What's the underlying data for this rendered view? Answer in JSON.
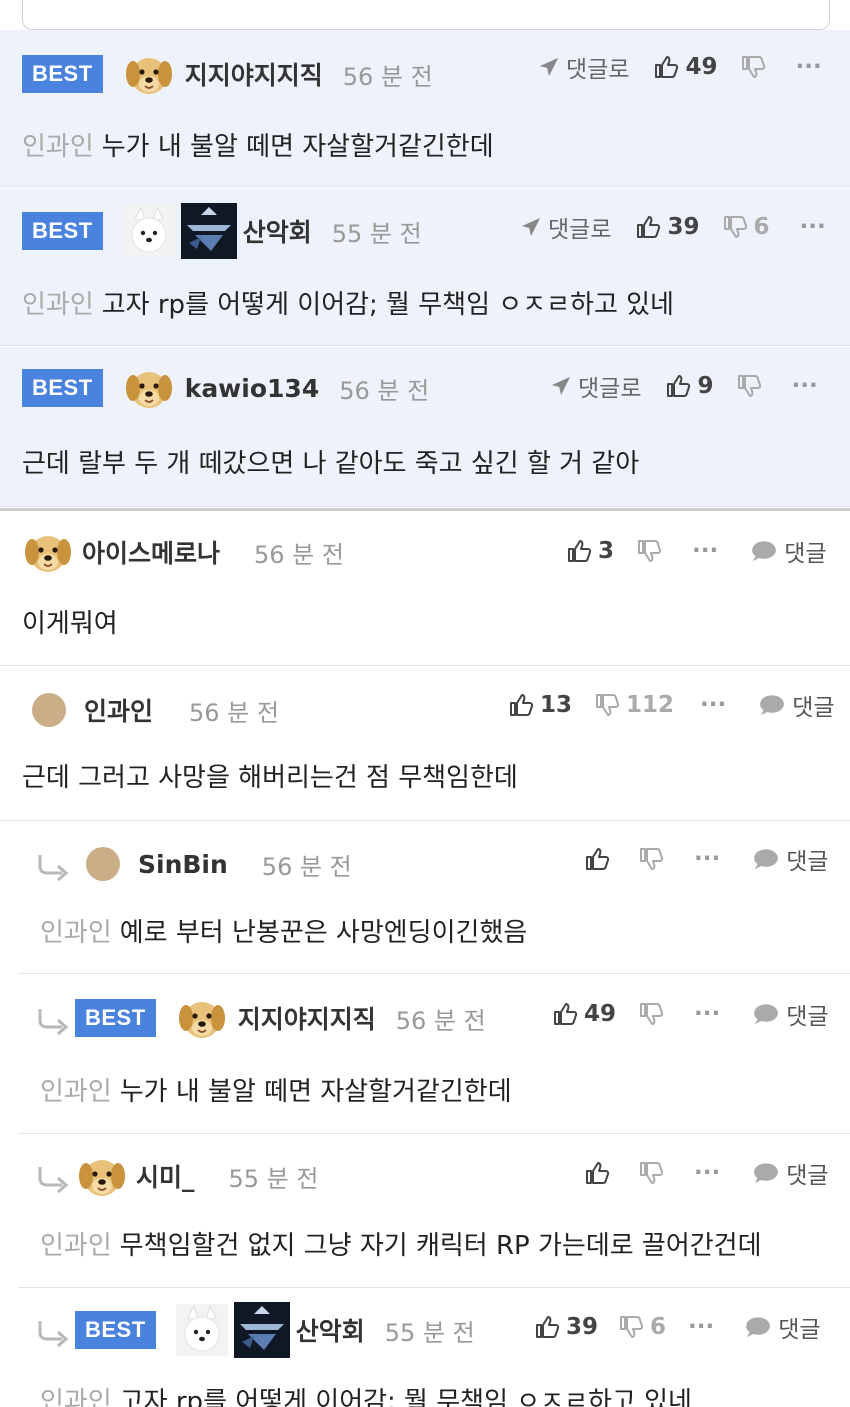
{
  "best_comments": [
    {
      "badge": "BEST",
      "nick": "지지야지지직",
      "time": "56 분 전",
      "reply_label": "댓글로",
      "likes": "49",
      "dislikes": "",
      "prefix": "인과인",
      "text": "누가 내 불알 떼면 자살할거같긴한데"
    },
    {
      "badge": "BEST",
      "nick": "산악회",
      "time": "55 분 전",
      "reply_label": "댓글로",
      "likes": "39",
      "dislikes": "6",
      "prefix": "인과인",
      "text": "고자 rp를 어떻게 이어감; 뭘 무책임 ㅇㅈㄹ하고 있네"
    },
    {
      "badge": "BEST",
      "nick": "kawio134",
      "time": "56 분 전",
      "reply_label": "댓글로",
      "likes": "9",
      "dislikes": "",
      "prefix": "",
      "text": "근데 랄부 두 개 떼갔으면 나 같아도 죽고 싶긴 할 거 같아"
    }
  ],
  "comments": [
    {
      "nick": "아이스메로나",
      "time": "56 분 전",
      "likes": "3",
      "dislikes": "",
      "reply_label": "댓글",
      "prefix": "",
      "text": "이게뭐여"
    },
    {
      "nick": "인과인",
      "time": "56 분 전",
      "likes": "13",
      "dislikes": "112",
      "reply_label": "댓글",
      "prefix": "",
      "text": "근데 그러고 사망을 해버리는건 점 무책임한데"
    }
  ],
  "replies": [
    {
      "badge": "",
      "nick": "SinBin",
      "time": "56 분 전",
      "likes": "",
      "dislikes": "",
      "reply_label": "댓글",
      "prefix": "인과인",
      "text": "예로 부터 난봉꾼은 사망엔딩이긴했음"
    },
    {
      "badge": "BEST",
      "nick": "지지야지지직",
      "time": "56 분 전",
      "likes": "49",
      "dislikes": "",
      "reply_label": "댓글",
      "prefix": "인과인",
      "text": "누가 내 불알 떼면 자살할거같긴한데"
    },
    {
      "badge": "",
      "nick": "시미_",
      "time": "55 분 전",
      "likes": "",
      "dislikes": "",
      "reply_label": "댓글",
      "prefix": "인과인",
      "text": "무책임할건 없지 그냥 자기 캐릭터 RP 가는데로 끌어간건데"
    },
    {
      "badge": "BEST",
      "nick": "산악회",
      "time": "55 분 전",
      "likes": "39",
      "dislikes": "6",
      "reply_label": "댓글",
      "prefix": "인과인",
      "text": "고자 rp를 어떻게 이어감; 뭘 무책임 ㅇㅈㄹ하고 있네"
    }
  ],
  "more_label": "···",
  "colors": {
    "best_badge": "#4a83dd",
    "best_bg": "#eef2fa",
    "muted": "#999999"
  },
  "icons": [
    "puppy-avatar-icon",
    "white-dog-avatar-icon",
    "clan-logo-icon",
    "tan-circle-avatar-icon",
    "thumbs-up-icon",
    "thumbs-down-icon",
    "send-arrow-icon",
    "speech-bubble-icon",
    "reply-arrow-icon",
    "more-icon"
  ]
}
